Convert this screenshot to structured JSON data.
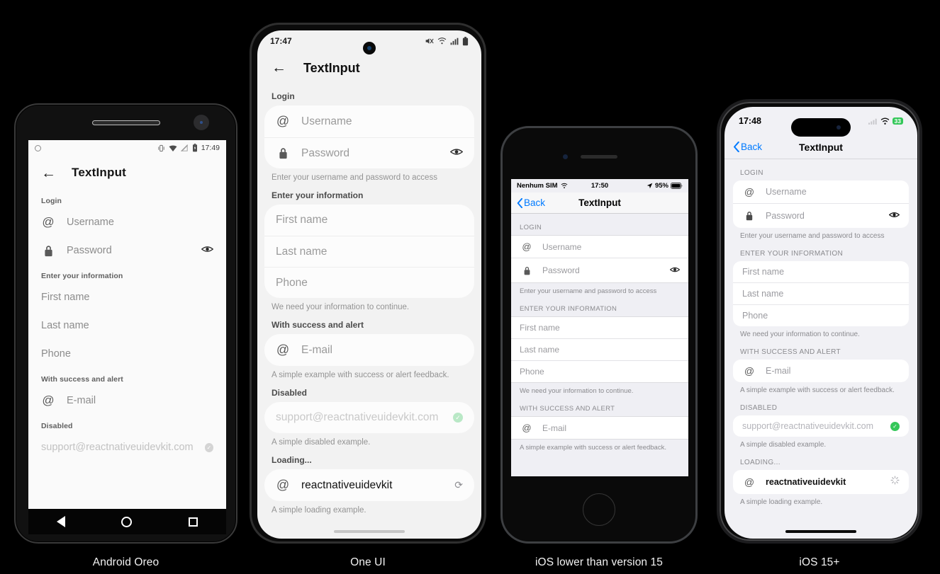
{
  "screen_title": "TextInput",
  "captions": {
    "android_oreo": "Android Oreo",
    "one_ui": "One UI",
    "ios_old": "iOS lower than version 15",
    "ios_new": "iOS 15+"
  },
  "sections": {
    "login_title_title": "Login",
    "login_title_caps": "LOGIN",
    "info_title": "Enter your information",
    "info_title_caps": "ENTER YOUR INFORMATION",
    "success_title": "With success and alert",
    "success_title_caps": "WITH SUCCESS AND ALERT",
    "disabled_title": "Disabled",
    "disabled_title_caps": "DISABLED",
    "loading_title": "Loading...",
    "loading_title_caps": "LOADING..."
  },
  "fields": {
    "username": "Username",
    "password": "Password",
    "first_name": "First name",
    "last_name": "Last name",
    "phone": "Phone",
    "email": "E-mail",
    "disabled_value": "support@reactnativeuidevkit.com",
    "loading_value": "reactnativeuidevkit"
  },
  "helpers": {
    "login": "Enter your username and password to access",
    "info": "We need your information to continue.",
    "success": "A simple example with success or alert feedback.",
    "disabled": "A simple disabled example.",
    "loading": "A simple loading example."
  },
  "icons": {
    "at": "@",
    "lock": "🔒",
    "eye": "👁",
    "back_arrow": "←",
    "chevron_left": "‹",
    "check": "✓",
    "spinner": "⟳"
  },
  "status_bars": {
    "android_oreo": {
      "time": "17:49",
      "icons": [
        "vibrate-icon",
        "wifi-icon",
        "signal-off-icon",
        "battery-icon"
      ]
    },
    "one_ui": {
      "time": "17:47",
      "icons": [
        "mute-icon",
        "wifi-icon",
        "signal-icon",
        "battery-icon"
      ]
    },
    "ios_old": {
      "carrier": "Nenhum SIM",
      "time": "17:50",
      "battery": "95%",
      "icons": [
        "wifi-icon",
        "location-icon",
        "battery-icon"
      ]
    },
    "ios_new": {
      "time": "17:48",
      "battery": "33",
      "icons": [
        "cellular-icon",
        "wifi-icon",
        "battery-icon"
      ]
    }
  },
  "nav": {
    "back_label": "Back",
    "android_buttons": [
      "back-triangle",
      "home-circle",
      "recents-square"
    ]
  },
  "colors": {
    "ios_blue": "#007aff",
    "success_green": "#34c759",
    "android_screen_bg": "#fafafa",
    "one_ui_bg": "#f2f2f2",
    "ios_bg": "#f1f1f5"
  }
}
